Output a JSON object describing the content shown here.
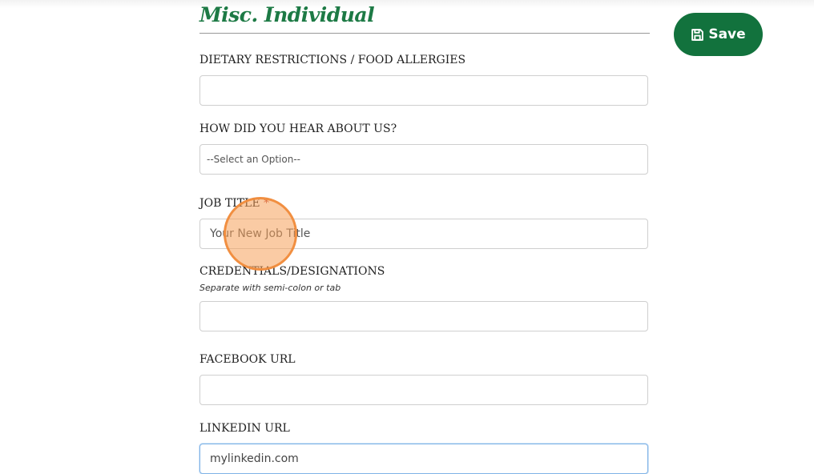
{
  "section": {
    "title": "Misc. Individual"
  },
  "save_button": {
    "label": "Save",
    "icon": "floppy-disk-icon"
  },
  "fields": {
    "dietary": {
      "label": "DIETARY RESTRICTIONS / FOOD ALLERGIES",
      "value": ""
    },
    "hear_about": {
      "label": "HOW DID YOU HEAR ABOUT US?",
      "selected": "--Select an Option--"
    },
    "job_title": {
      "label": "JOB TITLE",
      "required_mark": "*",
      "placeholder": "Your New Job Title"
    },
    "credentials": {
      "label": "CREDENTIALS/DESIGNATIONS",
      "hint": "Separate with semi-colon or tab",
      "value": ""
    },
    "facebook": {
      "label": "FACEBOOK URL",
      "value": ""
    },
    "linkedin": {
      "label": "LINKEDIN URL",
      "value": "mylinkedin.com"
    }
  },
  "colors": {
    "brand_green": "#12723d",
    "title_green": "#1d7a45",
    "click_marker": "#f5a05a"
  }
}
